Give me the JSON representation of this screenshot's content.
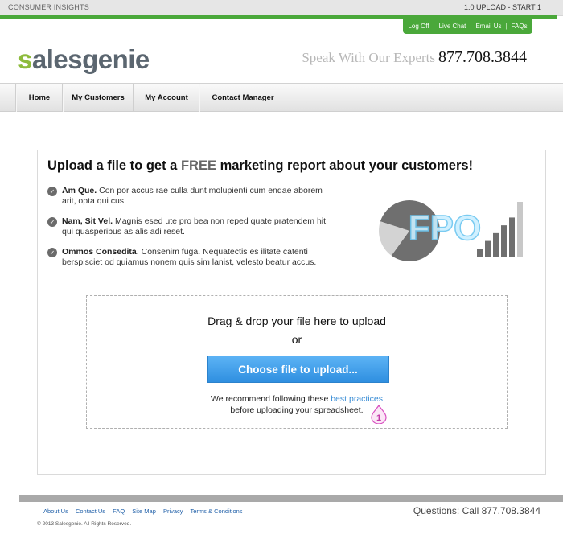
{
  "topbar": {
    "section_label": "CONSUMER INSIGHTS",
    "step_label": "1.0 UPLOAD - START 1"
  },
  "utility_links": [
    "Log Off",
    "Live Chat",
    "Email Us",
    "FAQs"
  ],
  "brand": {
    "logo_first": "s",
    "logo_rest": "alesgenie",
    "tagline": "Speak With Our Experts",
    "phone": "877.708.3844"
  },
  "nav": {
    "items": [
      "Home",
      "My Customers",
      "My Account",
      "Contact Manager"
    ]
  },
  "main": {
    "headline_pre": "Upload a file to get a",
    "headline_free": "FREE",
    "headline_post": "marketing report about your customers!",
    "bullets": [
      {
        "title": "Am Que.",
        "text": "Con por accus rae culla dunt molupienti cum endae aborem arit, opta qui cus."
      },
      {
        "title": "Nam, Sit Vel.",
        "text": "Magnis esed ute pro bea non reped quate pratendem hit, qui quasperibus as alis adi reset."
      },
      {
        "title": "Ommos Consedita",
        "text": ". Consenim fuga. Nequatectis es ilitate catenti berspisciet od quiamus nonem quis sim lanist, velesto beatur accus."
      }
    ],
    "placeholder_graphic_label": "FPO",
    "pie_data": [
      80,
      20
    ],
    "bar_data": [
      1,
      2,
      3,
      4,
      5,
      7
    ]
  },
  "upload": {
    "drag_text": "Drag & drop your file here to upload",
    "or_text": "or",
    "button_label": "Choose file to upload...",
    "recommend_pre": "We recommend following these",
    "recommend_link": "best practices",
    "recommend_post": "before uploading your spreadsheet.",
    "marker_number": "1"
  },
  "footer": {
    "links": [
      "About Us",
      "Contact Us",
      "FAQ",
      "Site Map",
      "Privacy",
      "Terms & Conditions"
    ],
    "copyright": "© 2013 Salesgenie. All Rights Reserved.",
    "questions": "Questions: Call 877.708.3844"
  },
  "colors": {
    "brand_green": "#4aa83a",
    "logo_accent": "#8dbb3c",
    "button_blue": "#3d9be6",
    "link_blue": "#3b8ed6",
    "marker_pink": "#d84fc0"
  }
}
